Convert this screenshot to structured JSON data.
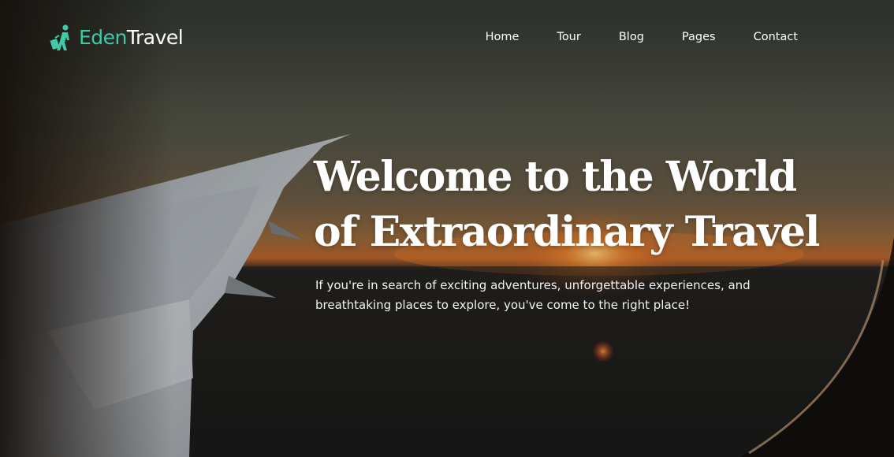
{
  "brand": {
    "name_part1": "Eden",
    "name_part2": "Travel",
    "icon": "traveler-icon",
    "accent_color": "#3ec9a7"
  },
  "nav": {
    "items": [
      "Home",
      "Tour",
      "Blog",
      "Pages",
      "Contact"
    ]
  },
  "hero": {
    "headline_line1": "Welcome to the World",
    "headline_line2": "of Extraordinary Travel",
    "subtext_line1": "If you're in search of exciting adventures, unforgettable experiences, and",
    "subtext_line2": "breathtaking places to explore, you've come to the right place!",
    "background": "airplane-wing-sunset-photo"
  }
}
